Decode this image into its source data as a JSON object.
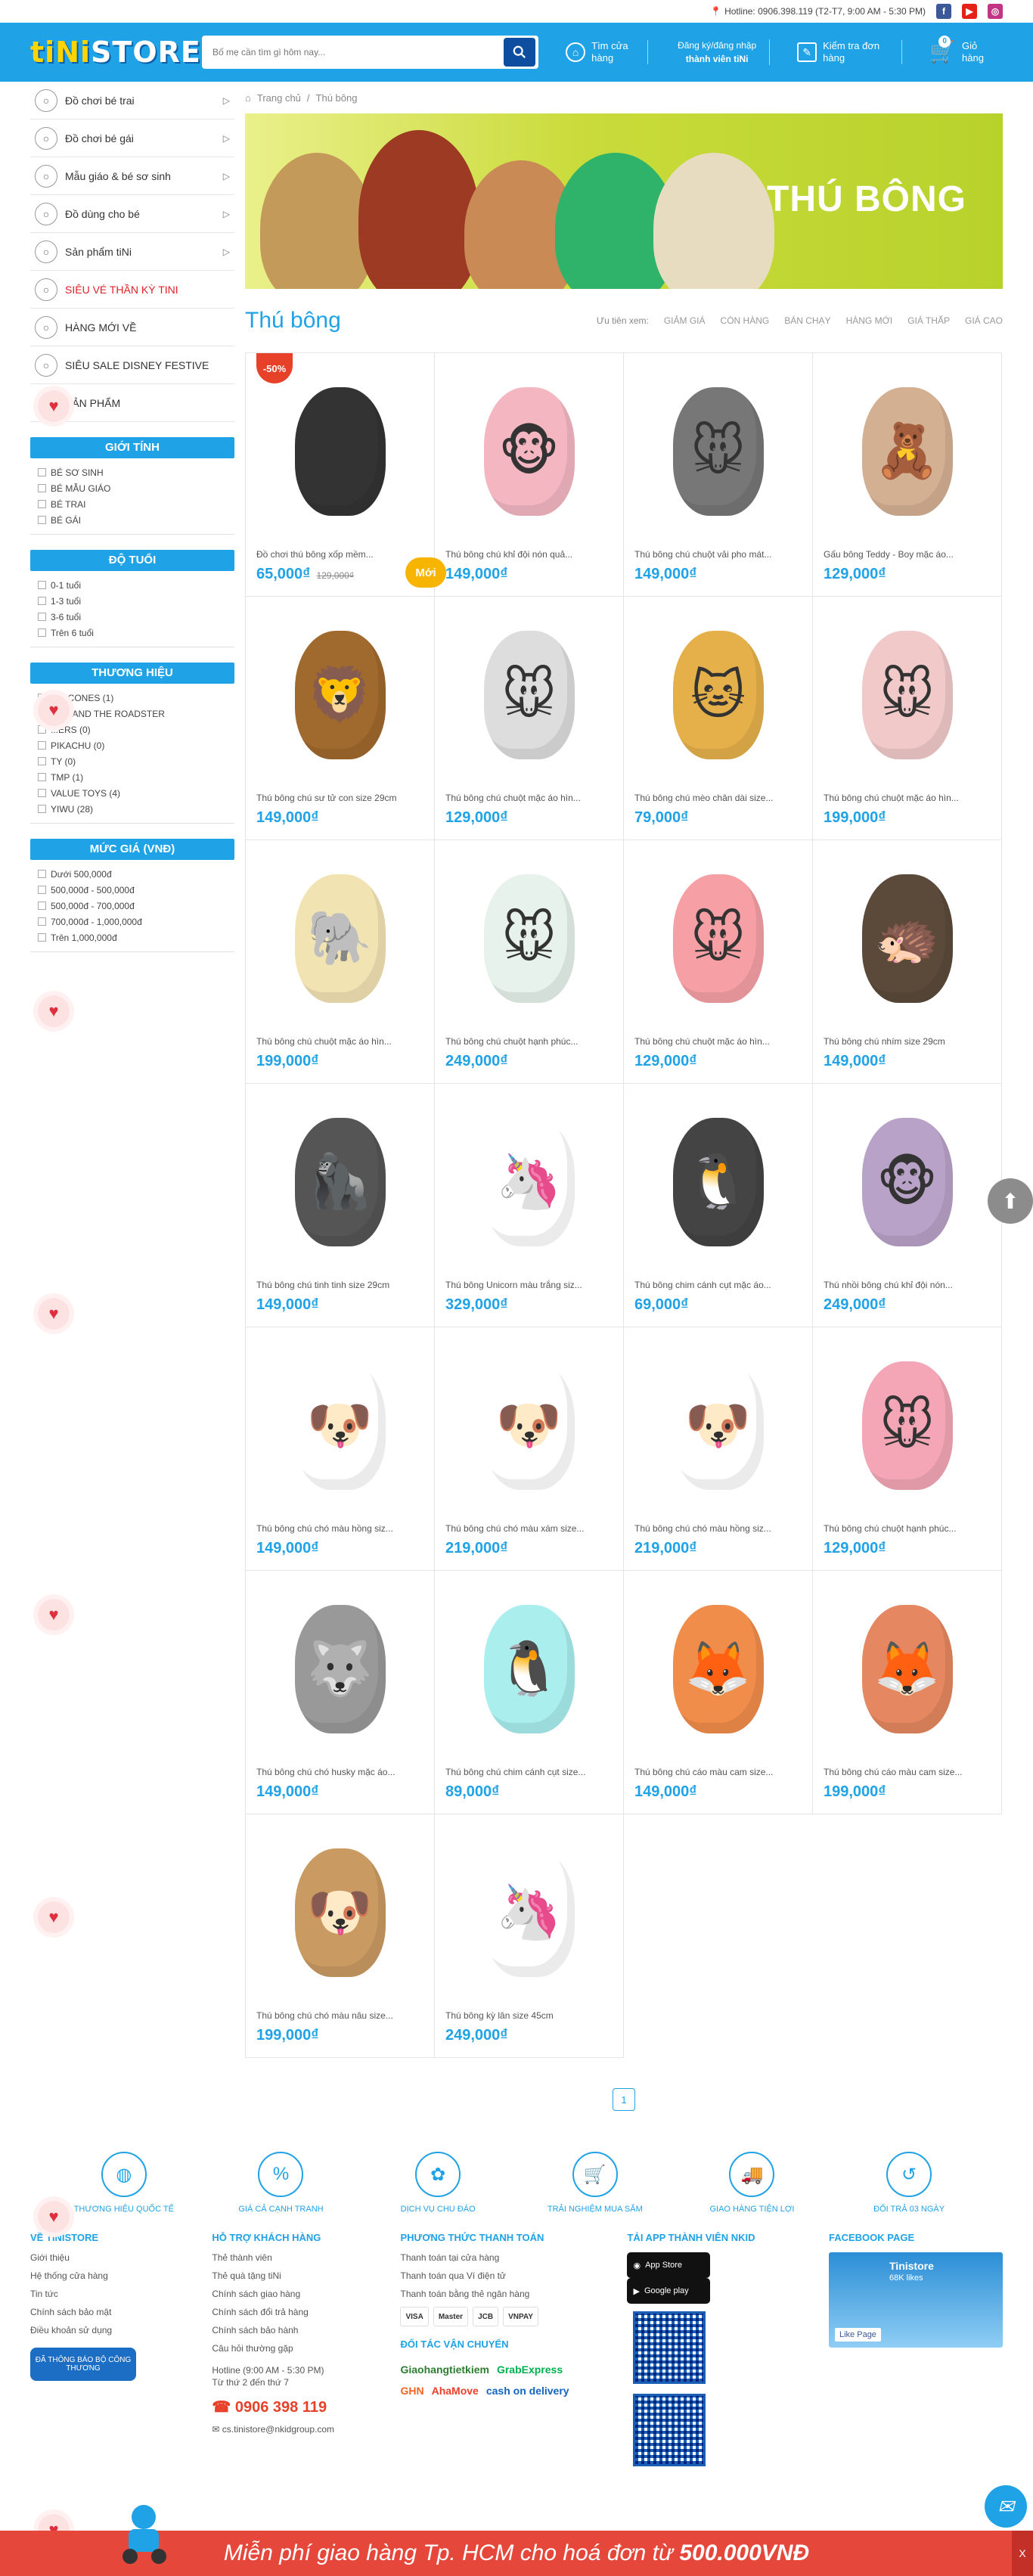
{
  "topbar": {
    "hotline": "Hotline: 0906.398.119 (T2-T7, 9:00 AM - 5:30 PM)",
    "social": [
      "f",
      "▶",
      "◎"
    ]
  },
  "header": {
    "logo_a": "tiNi",
    "logo_b": "STORE",
    "search_placeholder": "Bố mẹ cần tìm gì hôm nay...",
    "store": "Tìm cửa hàng",
    "login_a": "Đăng ký/đăng nhập",
    "login_b": "thành viên tiNi",
    "order": "Kiểm tra đơn hàng",
    "cart": "Giỏ hàng",
    "cart_count": "0"
  },
  "menu": [
    {
      "label": "Đồ chơi bé trai",
      "icon": "boy-toy-icon",
      "red": false,
      "chev": true
    },
    {
      "label": "Đồ chơi bé gái",
      "icon": "girl-toy-icon",
      "red": false,
      "chev": true
    },
    {
      "label": "Mẫu giáo & bé sơ sinh",
      "icon": "baby-icon",
      "red": false,
      "chev": true
    },
    {
      "label": "Đồ dùng cho bé",
      "icon": "baby-items-icon",
      "red": false,
      "chev": true
    },
    {
      "label": "Sản phẩm tiNi",
      "icon": "tini-icon",
      "red": false,
      "chev": true
    },
    {
      "label": "SIÊU VÉ THẦN KỲ TINI",
      "icon": "ticket-icon",
      "red": true,
      "chev": false
    },
    {
      "label": "HÀNG MỚI VỀ",
      "icon": "new-icon",
      "red": false,
      "chev": false
    },
    {
      "label": "SIÊU SALE DISNEY FESTIVE",
      "icon": "fire-icon",
      "red": false,
      "chev": false
    },
    {
      "label": "SẢN PHẨM",
      "icon": "product-icon",
      "red": false,
      "chev": false
    }
  ],
  "filters": [
    {
      "title": "GIỚI TÍNH",
      "items": [
        "BÉ SƠ SINH",
        "BÉ MẪU GIÁO",
        "BÉ TRAI",
        "BÉ GÁI"
      ]
    },
    {
      "title": "ĐỘ TUỔI",
      "items": [
        "0-1 tuổi",
        "1-3 tuổi",
        "3-6 tuổi",
        "Trên 6 tuổi"
      ]
    },
    {
      "title": "THƯƠNG HIỆU",
      "items": [
        "...O CONES (1)",
        "...EY AND THE ROADSTER",
        "...ERS (0)",
        "PIKACHU (0)",
        "TY (0)",
        "TMP (1)",
        "VALUE TOYS (4)",
        "YIWU (28)"
      ]
    },
    {
      "title": "MỨC GIÁ (VNĐ)",
      "items": [
        "Dưới 500,000đ",
        "500,000đ - 500,000đ",
        "500,000đ - 700,000đ",
        "700,000đ - 1,000,000đ",
        "Trên 1,000,000đ"
      ]
    }
  ],
  "breadcrumb": {
    "home": "Trang chủ",
    "sep": "/",
    "current": "Thú bông"
  },
  "banner": {
    "title": "THÚ BÔNG"
  },
  "category": {
    "title": "Thú bông",
    "sort_label": "Ưu tiên xem:",
    "sort": [
      "GIẢM GIÁ",
      "CÒN HÀNG",
      "BÁN CHẠY",
      "HÀNG MỚI",
      "GIÁ THẤP",
      "GIÁ CAO"
    ]
  },
  "products": [
    {
      "name": "Đồ chơi thú bông xốp mềm...",
      "price": "65,000₫",
      "old": "129,000₫",
      "sale": "-50%",
      "new": "Mới",
      "emoji": "🐭",
      "color": "#333"
    },
    {
      "name": "Thú bông chú khỉ đội nón quả...",
      "price": "149,000₫",
      "old": "",
      "sale": "",
      "new": "",
      "emoji": "🐵",
      "color": "#f4b7c2"
    },
    {
      "name": "Thú bông chú chuột vải pho mát...",
      "price": "149,000₫",
      "old": "",
      "sale": "",
      "new": "",
      "emoji": "🐭",
      "color": "#777"
    },
    {
      "name": "Gấu bông Teddy - Boy mặc áo...",
      "price": "129,000₫",
      "old": "",
      "sale": "",
      "new": "",
      "emoji": "🧸",
      "color": "#d4b093"
    },
    {
      "name": "Thú bông chú sư tử con size 29cm",
      "price": "149,000₫",
      "old": "",
      "sale": "",
      "new": "",
      "emoji": "🦁",
      "color": "#a0692e"
    },
    {
      "name": "Thú bông chú chuột mặc áo hìn...",
      "price": "129,000₫",
      "old": "",
      "sale": "",
      "new": "",
      "emoji": "🐭",
      "color": "#ddd"
    },
    {
      "name": "Thú bông chú mèo chân dài size...",
      "price": "79,000₫",
      "old": "",
      "sale": "",
      "new": "",
      "emoji": "🐱",
      "color": "#e5b04a"
    },
    {
      "name": "Thú bông chú chuột mặc áo hìn...",
      "price": "199,000₫",
      "old": "",
      "sale": "",
      "new": "",
      "emoji": "🐭",
      "color": "#f1c9c9"
    },
    {
      "name": "Thú bông chú chuột mặc áo hìn...",
      "price": "199,000₫",
      "old": "",
      "sale": "",
      "new": "",
      "emoji": "🐘",
      "color": "#f2e3b3"
    },
    {
      "name": "Thú bông chú chuột hạnh phúc...",
      "price": "249,000₫",
      "old": "",
      "sale": "",
      "new": "",
      "emoji": "🐭",
      "color": "#e8f2ec"
    },
    {
      "name": "Thú bông chú chuột mặc áo hìn...",
      "price": "129,000₫",
      "old": "",
      "sale": "",
      "new": "",
      "emoji": "🐭",
      "color": "#f6a0a5"
    },
    {
      "name": "Thú bông chú nhím size 29cm",
      "price": "149,000₫",
      "old": "",
      "sale": "",
      "new": "",
      "emoji": "🦔",
      "color": "#5b4a3a"
    },
    {
      "name": "Thú bông chú tinh tinh size 29cm",
      "price": "149,000₫",
      "old": "",
      "sale": "",
      "new": "",
      "emoji": "🦍",
      "color": "#555"
    },
    {
      "name": "Thú bông Unicorn màu trắng siz...",
      "price": "329,000₫",
      "old": "",
      "sale": "",
      "new": "",
      "emoji": "🦄",
      "color": "#fff"
    },
    {
      "name": "Thú bông chim cánh cụt mặc áo...",
      "price": "69,000₫",
      "old": "",
      "sale": "",
      "new": "",
      "emoji": "🐧",
      "color": "#444"
    },
    {
      "name": "Thú nhồi bông chú khỉ đội nón...",
      "price": "249,000₫",
      "old": "",
      "sale": "",
      "new": "",
      "emoji": "🐵",
      "color": "#b9a2c8"
    },
    {
      "name": "Thú bông chú chó màu hồng siz...",
      "price": "149,000₫",
      "old": "",
      "sale": "",
      "new": "",
      "emoji": "🐶",
      "color": "#fff"
    },
    {
      "name": "Thú bông chú chó màu xám size...",
      "price": "219,000₫",
      "old": "",
      "sale": "",
      "new": "",
      "emoji": "🐶",
      "color": "#fff"
    },
    {
      "name": "Thú bông chú chó màu hồng siz...",
      "price": "219,000₫",
      "old": "",
      "sale": "",
      "new": "",
      "emoji": "🐶",
      "color": "#fff"
    },
    {
      "name": "Thú bông chú chuột hạnh phúc...",
      "price": "129,000₫",
      "old": "",
      "sale": "",
      "new": "",
      "emoji": "🐭",
      "color": "#f4a6b6"
    },
    {
      "name": "Thú bông chú chó husky mặc áo...",
      "price": "149,000₫",
      "old": "",
      "sale": "",
      "new": "",
      "emoji": "🐺",
      "color": "#999"
    },
    {
      "name": "Thú bông chú chim cánh cụt size...",
      "price": "89,000₫",
      "old": "",
      "sale": "",
      "new": "",
      "emoji": "🐧",
      "color": "#aee"
    },
    {
      "name": "Thú bông chú cáo màu cam size...",
      "price": "149,000₫",
      "old": "",
      "sale": "",
      "new": "",
      "emoji": "🦊",
      "color": "#f08d4b"
    },
    {
      "name": "Thú bông chú cáo màu cam size...",
      "price": "199,000₫",
      "old": "",
      "sale": "",
      "new": "",
      "emoji": "🦊",
      "color": "#e58760"
    },
    {
      "name": "Thú bông chú chó màu nâu size...",
      "price": "199,000₫",
      "old": "",
      "sale": "",
      "new": "",
      "emoji": "🐶",
      "color": "#c99b62"
    },
    {
      "name": "Thú bông kỳ lân size 45cm",
      "price": "249,000₫",
      "old": "",
      "sale": "",
      "new": "",
      "emoji": "🦄",
      "color": "#fff"
    }
  ],
  "pager": {
    "current": "1"
  },
  "benefits": [
    "THƯƠNG HIỆU QUỐC TẾ",
    "GIÁ CẢ CẠNH TRANH",
    "DỊCH VỤ CHU ĐÁO",
    "TRẢI NGHIỆM MUA SẮM",
    "GIAO HÀNG TIỆN LỢI",
    "ĐỔI TRẢ 03 NGÀY"
  ],
  "footer": {
    "about": {
      "title": "VỀ TINISTORE",
      "links": [
        "Giới thiệu",
        "Hệ thống cửa hàng",
        "Tin tức",
        "Chính sách bảo mật",
        "Điều khoản sử dụng"
      ],
      "badge": "ĐÃ THÔNG BÁO BỘ CÔNG THƯƠNG"
    },
    "support": {
      "title": "HỖ TRỢ KHÁCH HÀNG",
      "links": [
        "Thẻ thành viên",
        "Thẻ quà tặng tiNi",
        "Chính sách giao hàng",
        "Chính sách đổi trả hàng",
        "Chính sách bảo hành",
        "Câu hỏi thường gặp"
      ],
      "hotline_a": "Hotline (9:00 AM - 5:30 PM)",
      "hotline_b": "Từ thứ 2 đến thứ 7",
      "phone": "0906 398 119",
      "email": "cs.tinistore@nkidgroup.com"
    },
    "payment": {
      "title": "PHƯƠNG THỨC THANH TOÁN",
      "links": [
        "Thanh toán tại cửa hàng",
        "Thanh toán qua Ví điện tử",
        "Thanh toán bằng thẻ ngân hàng"
      ],
      "cards": [
        "VISA",
        "Master",
        "JCB",
        "VNPAY"
      ],
      "partners_title": "ĐỐI TÁC VẬN CHUYỂN",
      "partners": [
        "Giaohangtietkiem",
        "GrabExpress",
        "GHN",
        "AhaMove",
        "cash on delivery"
      ]
    },
    "app": {
      "title": "TẢI APP THÀNH VIÊN NKID",
      "appstore": "App Store",
      "gplay": "Google play"
    },
    "facebook": {
      "title": "FACEBOOK PAGE",
      "name": "Tinistore",
      "likes": "68K likes",
      "like": "Like Page"
    }
  },
  "bottombar": {
    "text": "Miễn phí giao hàng Tp. HCM cho hoá đơn từ",
    "amount": "500.000VNĐ",
    "close": "X"
  }
}
